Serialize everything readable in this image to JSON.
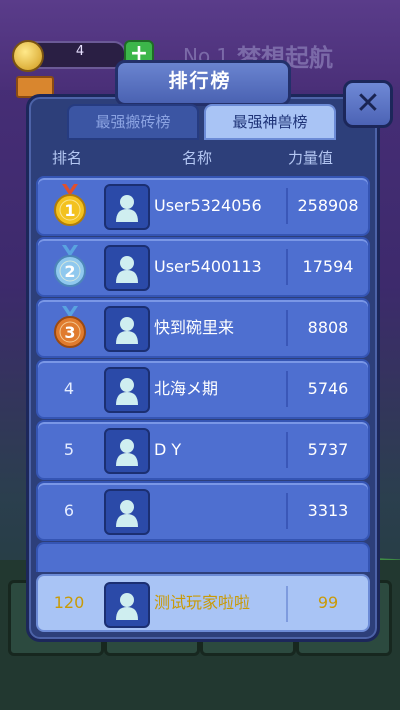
{
  "hud": {
    "coin_count": "4",
    "plus_label": "+",
    "level_label": "No.1",
    "level_name": "梦想起航"
  },
  "modal": {
    "title": "排行榜",
    "close_label": "✕",
    "tabs": [
      {
        "label": "最强搬砖榜",
        "active": false
      },
      {
        "label": "最强神兽榜",
        "active": true
      }
    ],
    "columns": {
      "rank": "排名",
      "name": "名称",
      "power": "力量值"
    }
  },
  "ranking": [
    {
      "rank": "1",
      "name": "User5324056",
      "power": "258908",
      "medal": "gold"
    },
    {
      "rank": "2",
      "name": "User5400113",
      "power": "17594",
      "medal": "silver"
    },
    {
      "rank": "3",
      "name": "快到碗里来",
      "power": "8808",
      "medal": "bronze"
    },
    {
      "rank": "4",
      "name": "北海メ期",
      "power": "5746"
    },
    {
      "rank": "5",
      "name": "D Y",
      "power": "5737"
    },
    {
      "rank": "6",
      "name": "",
      "power": "3313"
    }
  ],
  "my_rank": {
    "rank": "120",
    "name": "测试玩家啦啦",
    "power": "99"
  },
  "colors": {
    "modal_bg": "#2d3f7a",
    "row_bg": "#4e6fd0",
    "active_tab": "#a9c4f5",
    "my_rank_text": "#c99a06"
  }
}
